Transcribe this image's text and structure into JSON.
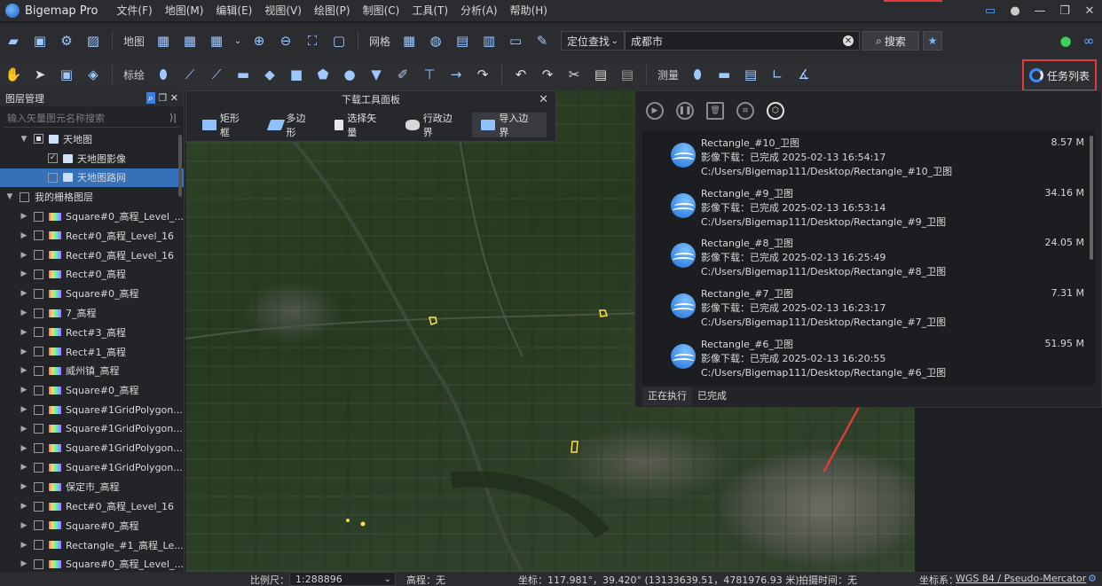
{
  "app": {
    "title": "Bigemap Pro"
  },
  "menu": [
    "文件(F)",
    "地图(M)",
    "编辑(E)",
    "视图(V)",
    "绘图(P)",
    "制图(C)",
    "工具(T)",
    "分析(A)",
    "帮助(H)"
  ],
  "toolbar1": {
    "map_label": "地图",
    "grid_label": "网格",
    "loc_select": "定位查找",
    "search_value": "成都市",
    "search_btn": "搜索"
  },
  "toolbar2": {
    "draw_label": "标绘",
    "measure_label": "测量",
    "task_list": "任务列表"
  },
  "layers": {
    "title": "图层管理",
    "search_placeholder": "输入矢量图元名称搜索",
    "items": [
      {
        "label": "天地图",
        "level": 1,
        "caret": "▼",
        "check": "part",
        "icon": "book"
      },
      {
        "label": "天地图影像",
        "level": 2,
        "caret": "",
        "check": "on",
        "icon": "book"
      },
      {
        "label": "天地图路网",
        "level": 2,
        "caret": "",
        "check": "off",
        "icon": "book",
        "selected": true
      },
      {
        "label": "我的栅格图层",
        "level": 0,
        "caret": "▼",
        "check": "off",
        "icon": ""
      },
      {
        "label": "Square#0_高程_Level_...",
        "level": 1,
        "caret": "▶",
        "check": "off",
        "icon": "rainbow"
      },
      {
        "label": "Rect#0_高程_Level_16",
        "level": 1,
        "caret": "▶",
        "check": "off",
        "icon": "rainbow"
      },
      {
        "label": "Rect#0_高程_Level_16",
        "level": 1,
        "caret": "▶",
        "check": "off",
        "icon": "rainbow"
      },
      {
        "label": "Rect#0_高程",
        "level": 1,
        "caret": "▶",
        "check": "off",
        "icon": "rainbow"
      },
      {
        "label": "Square#0_高程",
        "level": 1,
        "caret": "▶",
        "check": "off",
        "icon": "rainbow"
      },
      {
        "label": "7_高程",
        "level": 1,
        "caret": "▶",
        "check": "off",
        "icon": "rainbow"
      },
      {
        "label": "Rect#3_高程",
        "level": 1,
        "caret": "▶",
        "check": "off",
        "icon": "rainbow"
      },
      {
        "label": "Rect#1_高程",
        "level": 1,
        "caret": "▶",
        "check": "off",
        "icon": "rainbow"
      },
      {
        "label": "威州镇_高程",
        "level": 1,
        "caret": "▶",
        "check": "off",
        "icon": "rainbow"
      },
      {
        "label": "Square#0_高程",
        "level": 1,
        "caret": "▶",
        "check": "off",
        "icon": "rainbow"
      },
      {
        "label": "Square#1GridPolygon...",
        "level": 1,
        "caret": "▶",
        "check": "off",
        "icon": "rainbow"
      },
      {
        "label": "Square#1GridPolygon...",
        "level": 1,
        "caret": "▶",
        "check": "off",
        "icon": "rainbow"
      },
      {
        "label": "Square#1GridPolygon...",
        "level": 1,
        "caret": "▶",
        "check": "off",
        "icon": "rainbow"
      },
      {
        "label": "Square#1GridPolygon...",
        "level": 1,
        "caret": "▶",
        "check": "off",
        "icon": "rainbow"
      },
      {
        "label": "保定市_高程",
        "level": 1,
        "caret": "▶",
        "check": "off",
        "icon": "rainbow"
      },
      {
        "label": "Rect#0_高程_Level_16",
        "level": 1,
        "caret": "▶",
        "check": "off",
        "icon": "rainbow"
      },
      {
        "label": "Square#0_高程",
        "level": 1,
        "caret": "▶",
        "check": "off",
        "icon": "rainbow"
      },
      {
        "label": "Rectangle_#1_高程_Le...",
        "level": 1,
        "caret": "▶",
        "check": "off",
        "icon": "rainbow"
      },
      {
        "label": "Square#0_高程_Level_...",
        "level": 1,
        "caret": "▶",
        "check": "off",
        "icon": "rainbow"
      }
    ]
  },
  "download_panel": {
    "title": "下载工具面板",
    "buttons": [
      "矩形框",
      "多边形",
      "选择矢量",
      "行政边界",
      "导入边界"
    ]
  },
  "tasks": {
    "items": [
      {
        "name": "Rectangle_#10_卫图",
        "status": "影像下载：已完成 2025-02-13 16:54:17",
        "path": "C:/Users/Bigemap111/Desktop/Rectangle_#10_卫图",
        "size": "8.57 M"
      },
      {
        "name": "Rectangle_#9_卫图",
        "status": "影像下载：已完成 2025-02-13 16:53:14",
        "path": "C:/Users/Bigemap111/Desktop/Rectangle_#9_卫图",
        "size": "34.16 M"
      },
      {
        "name": "Rectangle_#8_卫图",
        "status": "影像下载：已完成 2025-02-13 16:25:49",
        "path": "C:/Users/Bigemap111/Desktop/Rectangle_#8_卫图",
        "size": "24.05 M"
      },
      {
        "name": "Rectangle_#7_卫图",
        "status": "影像下载：已完成 2025-02-13 16:23:17",
        "path": "C:/Users/Bigemap111/Desktop/Rectangle_#7_卫图",
        "size": "7.31 M"
      },
      {
        "name": "Rectangle_#6_卫图",
        "status": "影像下载：已完成 2025-02-13 16:20:55",
        "path": "C:/Users/Bigemap111/Desktop/Rectangle_#6_卫图",
        "size": "51.95 M"
      }
    ],
    "tab_running": "正在执行",
    "tab_done": "已完成"
  },
  "statusbar": {
    "scale_label": "比例尺：",
    "scale_value": "1:288896",
    "elevation": "高程：无",
    "coords": "坐标：117.981°，39.420°  (13133639.51，4781976.93 米)",
    "capture_time": "拍摄时间：无",
    "crs_label": "坐标系：",
    "crs_value": "WGS 84 / Pseudo-Mercator"
  },
  "colors": {
    "accent": "#3b8cff",
    "highlight": "#e23b3b",
    "selected_row": "#3570b8"
  }
}
